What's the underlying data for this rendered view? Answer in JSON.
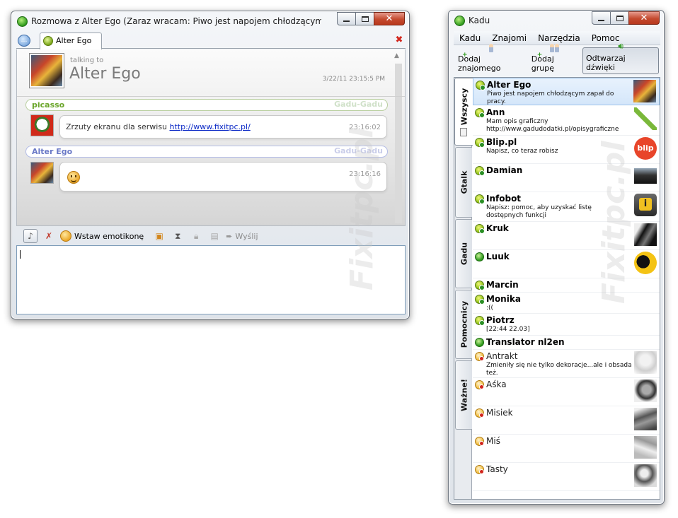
{
  "chat_window": {
    "title": "Rozmowa z Alter Ego (Zaraz wracam: Piwo jest napojem chłodzącym zapał do ...",
    "tab_label": "Alter Ego",
    "header": {
      "talking_to_label": "talking to",
      "peer_name": "Alter Ego",
      "timestamp": "3/22/11 23:15:5 PM"
    },
    "messages": [
      {
        "sender": "picasso",
        "protocol": "Gadu-Gadu",
        "text": "Zrzuty ekranu dla serwisu ",
        "link": "http://www.fixitpc.pl/",
        "time": "23:16:02"
      },
      {
        "sender": "Alter Ego",
        "protocol": "Gadu-Gadu",
        "text": "",
        "emoticon": "smiley",
        "time": "23:16:16"
      }
    ],
    "toolbar": {
      "emoticon_label": "Wstaw emotikonę",
      "send_label": "Wyślij"
    },
    "input_value": ""
  },
  "kadu_window": {
    "title": "Kadu",
    "menu": [
      "Kadu",
      "Znajomi",
      "Narzędzia",
      "Pomoc"
    ],
    "actions": [
      {
        "label": "Dodaj znajomego",
        "icon": "add-user-icon"
      },
      {
        "label": "Dodaj grupę",
        "icon": "add-group-icon"
      },
      {
        "label": "Odtwarzaj dźwięki",
        "icon": "speaker-icon",
        "pressed": true
      }
    ],
    "groups": [
      "Wszyscy",
      "Gtalk",
      "Gadu",
      "Pomocnicy",
      "Ważne!"
    ],
    "active_group": "Wszyscy",
    "contacts": [
      {
        "name": "Alter Ego",
        "description": "Piwo jest napojem chłodzącym zapał do pracy.",
        "status": "online",
        "selected": true
      },
      {
        "name": "Ann",
        "description": "Mam opis graficzny\nhttp://www.gadudodatki.pl/opisygraficzne",
        "status": "online"
      },
      {
        "name": "Blip.pl",
        "description": "Napisz, co teraz robisz",
        "status": "online",
        "avatar_text": "blip"
      },
      {
        "name": "Damian",
        "description": "",
        "status": "online"
      },
      {
        "name": "Infobot",
        "description": "Napisz: pomoc, aby uzyskać listę dostępnych funkcji",
        "status": "online",
        "avatar_text": "i"
      },
      {
        "name": "Kruk",
        "description": "",
        "status": "online"
      },
      {
        "name": "Luuk",
        "description": "",
        "status": "green"
      },
      {
        "name": "Marcin",
        "description": "",
        "status": "online"
      },
      {
        "name": "Monika",
        "description": ":((",
        "status": "online"
      },
      {
        "name": "Piotrz",
        "description": "[22:44 22.03]",
        "status": "online"
      },
      {
        "name": "Translator nl2en",
        "description": "",
        "status": "green"
      },
      {
        "name": "Antrakt",
        "description": "Zmieniły się nie tylko dekoracje...ale i obsada też.",
        "status": "offline"
      },
      {
        "name": "Aśka",
        "description": "",
        "status": "offline"
      },
      {
        "name": "Misiek",
        "description": "",
        "status": "offline"
      },
      {
        "name": "Miś",
        "description": "",
        "status": "offline"
      },
      {
        "name": "Tasty",
        "description": "",
        "status": "offline"
      }
    ]
  },
  "watermark": "Fixitpc.pl"
}
